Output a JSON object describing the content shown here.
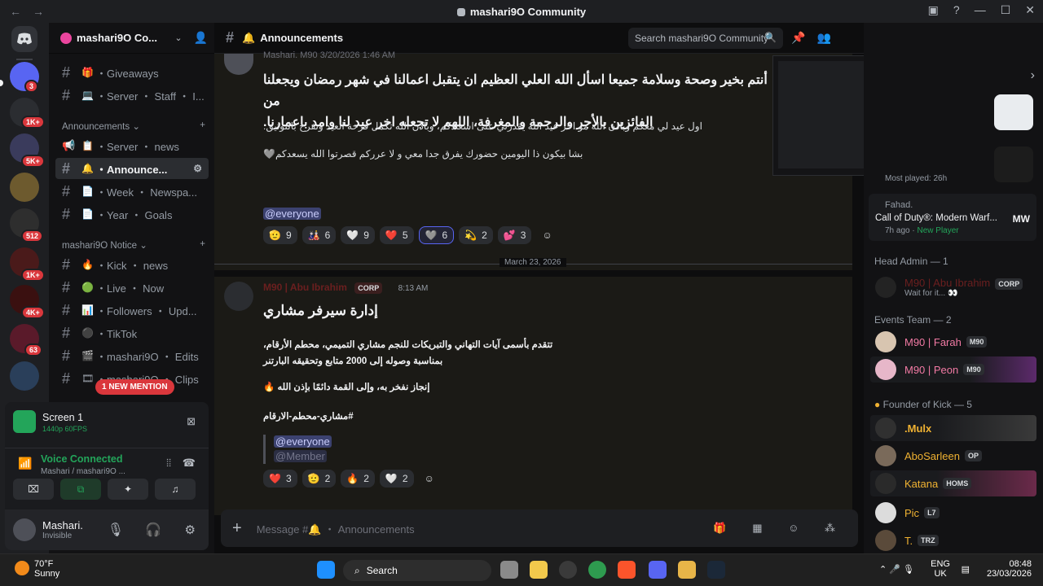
{
  "window": {
    "title": "mashari9O Community"
  },
  "rail": {
    "badges": [
      "3",
      "1K+",
      "5K+",
      "512",
      "1K+",
      "4K+",
      "63"
    ]
  },
  "sidebar": {
    "server_name": "mashari9O Co...",
    "channels_top": [
      {
        "icon": "gift-icon",
        "emoji": "🎁",
        "label": "・Giveaways"
      },
      {
        "icon": "laptop-icon",
        "emoji": "💻",
        "label": "・Server ・ Staff ・ I..."
      }
    ],
    "category_announcements": "Announcements",
    "channels_ann": [
      {
        "icon": "megaphone-icon",
        "emoji": "📋",
        "label": "・Server ・ news"
      },
      {
        "icon": "bell-icon",
        "emoji": "🔔",
        "label": "・Announce..."
      },
      {
        "icon": "document-icon",
        "emoji": "📄",
        "label": "・Week ・ Newspa..."
      },
      {
        "icon": "document-icon",
        "emoji": "📄",
        "label": "・Year ・ Goals"
      }
    ],
    "category_notice": "mashari9O Notice",
    "channels_notice": [
      {
        "icon": "fire-icon",
        "emoji": "🔥",
        "label": "・Kick ・ news"
      },
      {
        "icon": "live-dot-icon",
        "emoji": "🟢",
        "label": "・Live ・ Now"
      },
      {
        "icon": "chart-icon",
        "emoji": "📊",
        "label": "・Followers ・ Upd..."
      },
      {
        "icon": "circle-icon",
        "emoji": "⚫",
        "label": "・TikTok"
      },
      {
        "icon": "edits-icon",
        "emoji": "🎬",
        "label": "・mashari9O ・ Edits"
      },
      {
        "icon": "clips-icon",
        "emoji": "🎞",
        "label": "・mashari9O ・ Clips"
      }
    ],
    "new_mention": "1 NEW MENTION"
  },
  "voice_panel": {
    "stream_title": "Screen 1",
    "stream_quality": "1440p 60FPS",
    "status": "Voice Connected",
    "location": "Mashari / mashari9O ...",
    "user_name": "Mashari.",
    "user_status": "Invisible"
  },
  "channel": {
    "name": "Announcements",
    "search_placeholder": "Search mashari9O Community",
    "composer_placeholder": "Message #🔔 ・ Announcements"
  },
  "messages": [
    {
      "author": "Mashari.",
      "role_badge": "M90",
      "timestamp": "3/20/2026 1:46 AM",
      "lines": [
        "أنتم بخير وصحة وسلامة جميعا اسأل الله العلي العظيم ان يتقبل اعمالنا في شهر رمضان ويجعلنا من",
        "الفائزين بالأجر والرحمة والمغرفة، اللهم لا تجعله اخر عيد لنا وامد باعمارنا.",
        "اول عيد لي معكم وباذن الله مو اخر عيد الله يقدرني على اسعادكم، وباذن الله تكمل فرحة العيد ونفرح بالتوثيق.",
        "بشا بيكون ذا اليومين حضورك يفرق جدا معي و لا عرركم قصرتوا الله يسعدكم🩶"
      ],
      "mention": "@everyone",
      "reactions": [
        {
          "emoji": "🫡",
          "count": "9"
        },
        {
          "emoji": "🎎",
          "count": "6"
        },
        {
          "emoji": "🤍",
          "count": "9"
        },
        {
          "emoji": "❤️",
          "count": "5"
        },
        {
          "emoji": "🩶",
          "count": "6"
        },
        {
          "emoji": "💫",
          "count": "2"
        },
        {
          "emoji": "💕",
          "count": "3"
        }
      ]
    },
    {
      "author": "M90 | Abu Ibrahim",
      "role_badge": "CORP",
      "timestamp": "8:13 AM",
      "heading": "إدارة سيرفر مشاري",
      "lines": [
        "تتقدم بأسمى آيات التهاني والتبريكات للنجم مشاري التميمي، محطم الأرقام،",
        "بمناسبة وصوله إلى 2000 متابع وتحقيقه البارتنر",
        "إنجاز نفخر به، وإلى القمة دائمًا بإذن الله 🔥",
        "#مشاري-محطم-الارقام"
      ],
      "quote": [
        "@everyone",
        "@Member"
      ],
      "reactions": [
        {
          "emoji": "❤️",
          "count": "3"
        },
        {
          "emoji": "🫡",
          "count": "2"
        },
        {
          "emoji": "🔥",
          "count": "2"
        },
        {
          "emoji": "🤍",
          "count": "2"
        }
      ]
    }
  ],
  "date_divider": "March 23, 2026",
  "members": {
    "activity": {
      "most_played": "Most played: 26h",
      "user": "Fahad.",
      "game": "Call of Duty®: Modern Warf...",
      "when": "7h ago",
      "tag": "New Player"
    },
    "groups": [
      {
        "title": "Head Admin — 1",
        "list": [
          {
            "name": "M90 | Abu Ibrahim",
            "tag": "CORP",
            "status": "Wait for it... 👀"
          }
        ]
      },
      {
        "title": "Events Team — 2",
        "list": [
          {
            "name": "M90 | Farah",
            "tag": "M90"
          },
          {
            "name": "M90 | Peon",
            "tag": "M90"
          }
        ]
      },
      {
        "title": "Founder of Kick — 5",
        "list": [
          {
            "name": ".Mulx",
            "tag": ""
          },
          {
            "name": "AboSarleen",
            "tag": "OP"
          },
          {
            "name": "Katana",
            "tag": "HOMS"
          },
          {
            "name": "Pic",
            "tag": "L7"
          },
          {
            "name": "T.",
            "tag": "TRZ"
          }
        ]
      }
    ]
  },
  "taskbar": {
    "weather_temp": "70°F",
    "weather_desc": "Sunny",
    "search": "Search",
    "lang": "ENG",
    "region": "UK",
    "time": "08:48",
    "date": "23/03/2026"
  }
}
